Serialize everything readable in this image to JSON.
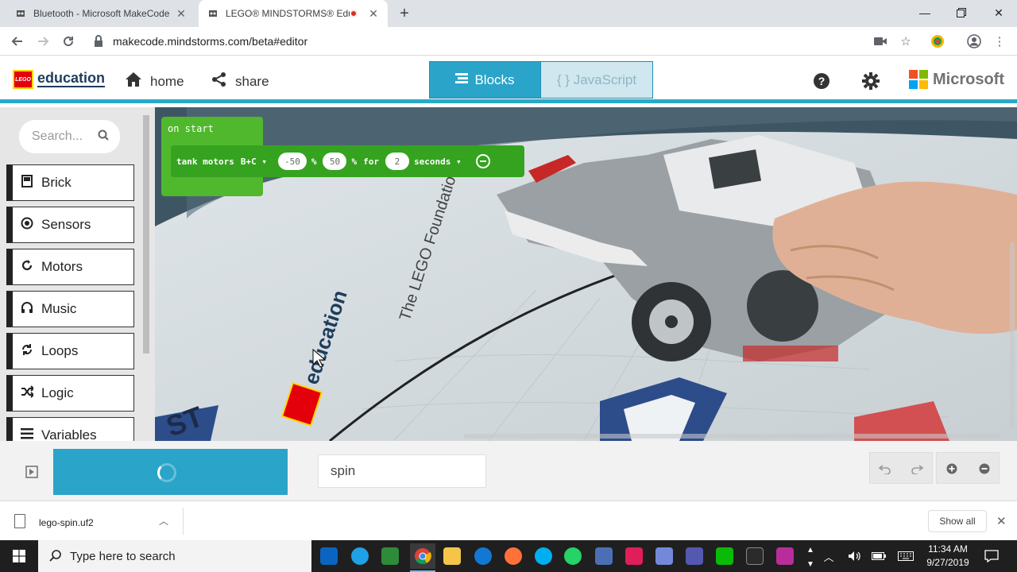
{
  "browser": {
    "tabs": [
      {
        "title": "Bluetooth - Microsoft MakeCode",
        "active": false
      },
      {
        "title": "LEGO® MINDSTORMS® Edu",
        "active": true
      }
    ],
    "url": "makecode.mindstorms.com/beta#editor"
  },
  "header": {
    "brand": "education",
    "brand_logo": "LEGO",
    "nav": [
      {
        "label": "home",
        "icon": "home-icon"
      },
      {
        "label": "share",
        "icon": "share-icon"
      }
    ],
    "blocks_label": "Blocks",
    "javascript_label": "{ } JavaScript",
    "ms_label": "Microsoft",
    "accent": "#29a9c8"
  },
  "toolbox": {
    "search_placeholder": "Search...",
    "categories": [
      {
        "label": "Brick",
        "icon": "brick-icon"
      },
      {
        "label": "Sensors",
        "icon": "sensors-icon"
      },
      {
        "label": "Motors",
        "icon": "motors-icon"
      },
      {
        "label": "Music",
        "icon": "music-icon"
      },
      {
        "label": "Loops",
        "icon": "loops-icon"
      },
      {
        "label": "Logic",
        "icon": "logic-icon"
      },
      {
        "label": "Variables",
        "icon": "variables-icon"
      }
    ]
  },
  "workspace": {
    "on_start": "on start",
    "block": {
      "label": "tank motors",
      "ports": "B+C",
      "left_speed": "-50",
      "pct1": "%",
      "right_speed": "50",
      "pct2": "%",
      "for_word": "for",
      "duration": "2",
      "unit": "seconds"
    },
    "block_color": "#4fb82d"
  },
  "editor_bar": {
    "project_name": "spin"
  },
  "download_shelf": {
    "file": "lego-spin.uf2",
    "show_all": "Show all"
  },
  "taskbar": {
    "search_placeholder": "Type here to search",
    "time": "11:34 AM",
    "date": "9/27/2019"
  }
}
